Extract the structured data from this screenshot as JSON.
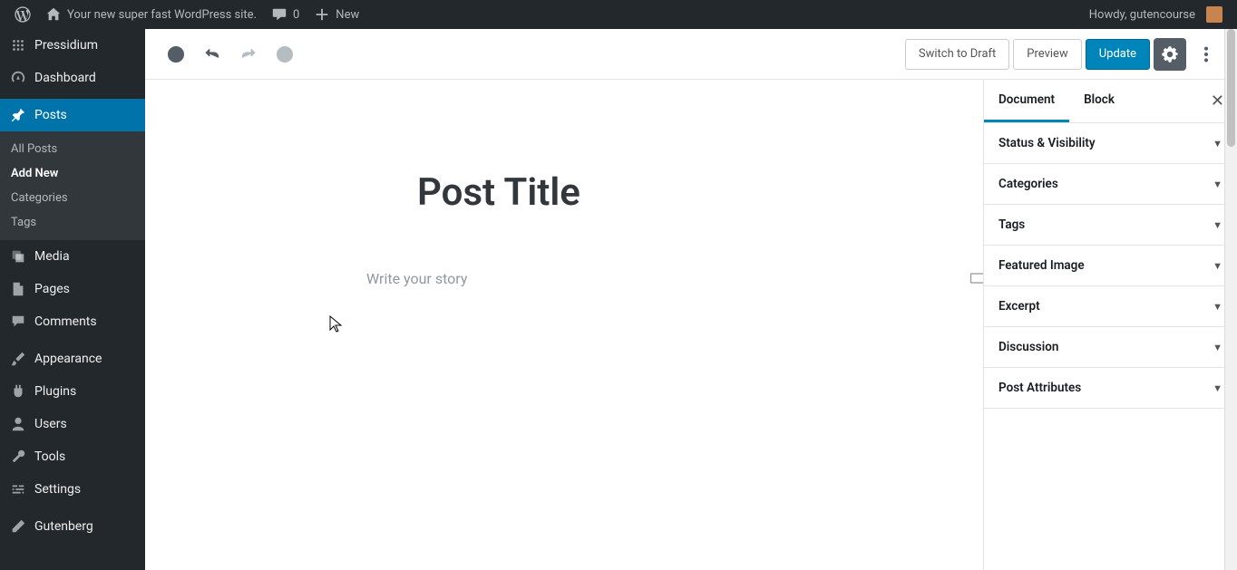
{
  "adminbar": {
    "site_name": "Your new super fast WordPress site.",
    "comments_count": "0",
    "new_label": "New",
    "howdy": "Howdy, gutencourse"
  },
  "sidebar": {
    "items": [
      {
        "label": "Pressidium"
      },
      {
        "label": "Dashboard"
      },
      {
        "label": "Posts"
      },
      {
        "label": "Media"
      },
      {
        "label": "Pages"
      },
      {
        "label": "Comments"
      },
      {
        "label": "Appearance"
      },
      {
        "label": "Plugins"
      },
      {
        "label": "Users"
      },
      {
        "label": "Tools"
      },
      {
        "label": "Settings"
      },
      {
        "label": "Gutenberg"
      }
    ],
    "posts_sub": [
      {
        "label": "All Posts"
      },
      {
        "label": "Add New"
      },
      {
        "label": "Categories"
      },
      {
        "label": "Tags"
      }
    ]
  },
  "editor": {
    "switch_draft": "Switch to Draft",
    "preview": "Preview",
    "update": "Update",
    "post_title": "Post Title",
    "story_placeholder": "Write your story"
  },
  "settings": {
    "tabs": {
      "document": "Document",
      "block": "Block"
    },
    "panels": [
      "Status & Visibility",
      "Categories",
      "Tags",
      "Featured Image",
      "Excerpt",
      "Discussion",
      "Post Attributes"
    ]
  }
}
